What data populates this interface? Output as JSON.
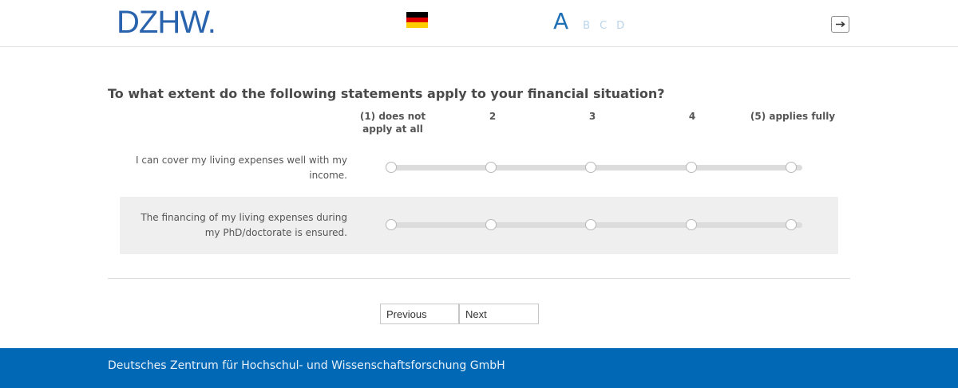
{
  "header": {
    "logo": "DZHW.",
    "flag_colors": [
      "#000000",
      "#dd0000",
      "#ffce00"
    ],
    "font_sizes": [
      "A",
      "B",
      "C",
      "D"
    ],
    "active_size": "A",
    "exit_icon": "logout-icon"
  },
  "question": {
    "title": "To what extent do the following statements apply to your financial situation?",
    "scale_labels": [
      "(1) does not apply at all",
      "2",
      "3",
      "4",
      "(5) applies fully"
    ],
    "items": [
      {
        "label": "I can cover my living expenses well with my income."
      },
      {
        "label": "The financing of my living expenses during my PhD/doctorate is ensured."
      }
    ]
  },
  "navigation": {
    "previous_label": "Previous",
    "next_label": "Next"
  },
  "footer": {
    "text": "Deutsches Zentrum für Hochschul- und Wissenschaftsforschung GmbH"
  },
  "colors": {
    "brand_blue": "#2a63ad",
    "footer_blue": "#0068b4"
  }
}
